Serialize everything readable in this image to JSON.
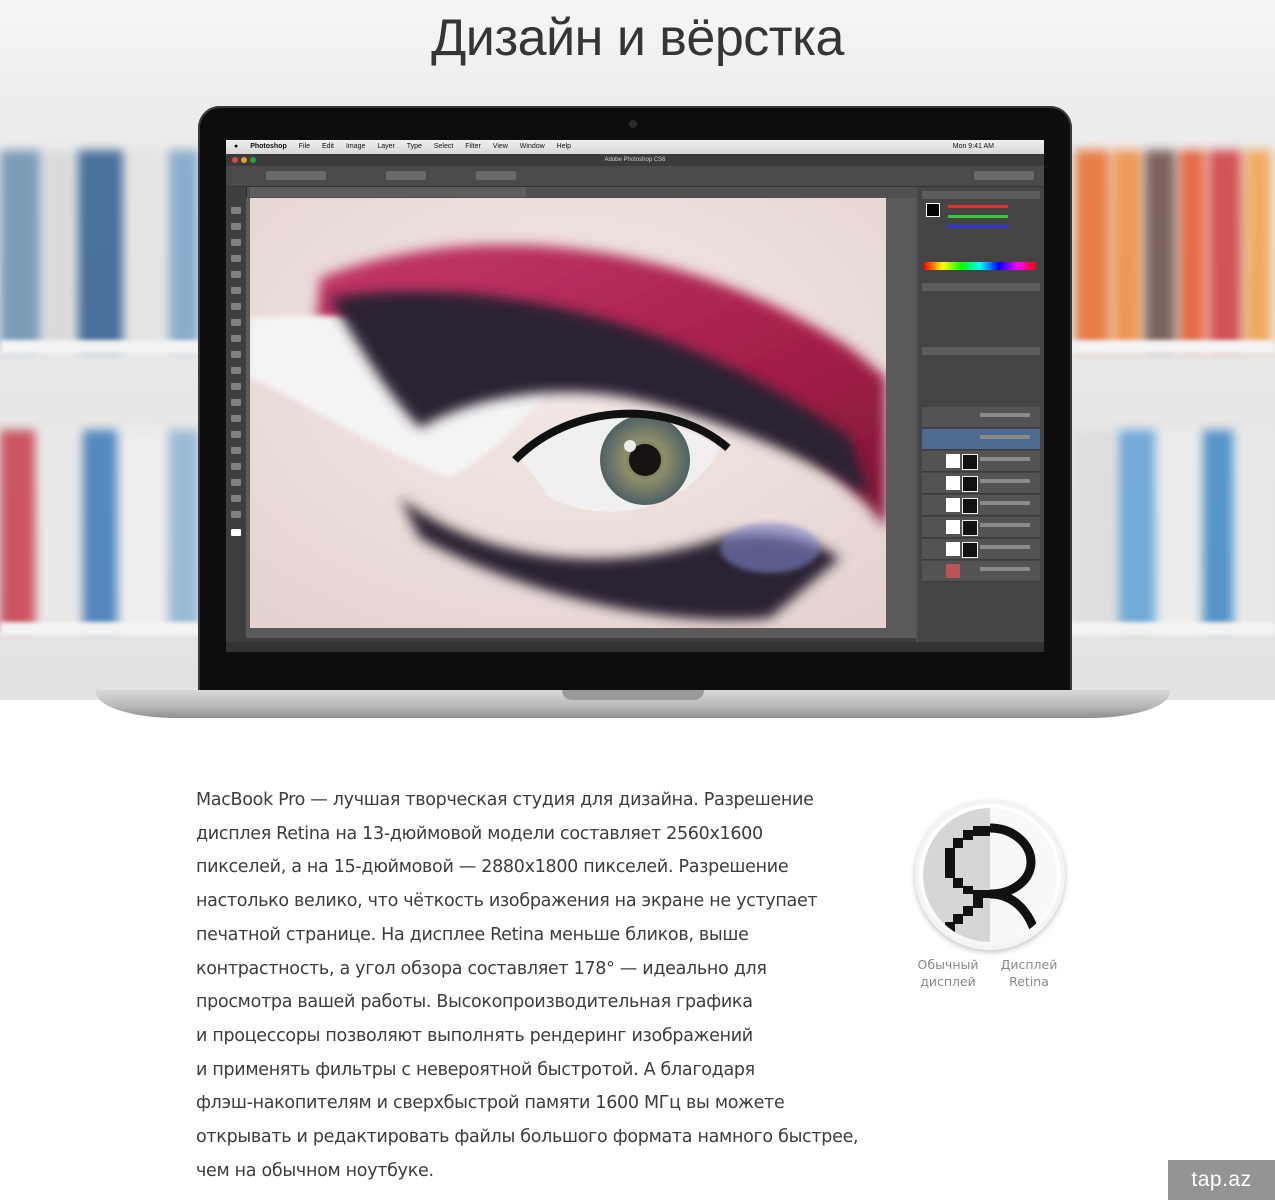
{
  "heading": "Дизайн и вёрстка",
  "screen": {
    "menu": [
      "Photoshop",
      "File",
      "Edit",
      "Image",
      "Layer",
      "Type",
      "Select",
      "Filter",
      "View",
      "Window",
      "Help"
    ],
    "clock": "Mon 9:41 AM",
    "window_title": "Adobe Photoshop CS6"
  },
  "description_lines": [
    "MacBook Pro — лучшая творческая студия для дизайна. Разрешение",
    "дисплея Retina на 13-дюймовой модели составляет 2560x1600",
    "пикселей, а на 15-дюймовой — 2880x1800 пикселей. Разрешение",
    "настолько велико, что чёткость изображения на экране не уступает",
    "печатной странице. На дисплее Retina меньше бликов, выше",
    "контрастность, а угол обзора составляет 178° — идеально для",
    "просмотра вашей работы. Высокопроизводительная графика",
    "и процессоры позволяют выполнять рендеринг изображений",
    "и применять фильтры с невероятной быстротой. А благодаря",
    "флэш-накопителям и сверхбыстрой памяти 1600 МГц вы можете",
    "открывать и редактировать файлы большого формата намного быстрее,",
    "чем на обычном ноутбуке."
  ],
  "comparison": {
    "left_line1": "Обычный",
    "left_line2": "дисплей",
    "right_line1": "Дисплей",
    "right_line2": "Retina"
  },
  "watermark": "tap.az",
  "colors": {
    "eyeshadow": "#b0244f",
    "ui_dark": "#505050",
    "text": "#3d3d3d"
  }
}
